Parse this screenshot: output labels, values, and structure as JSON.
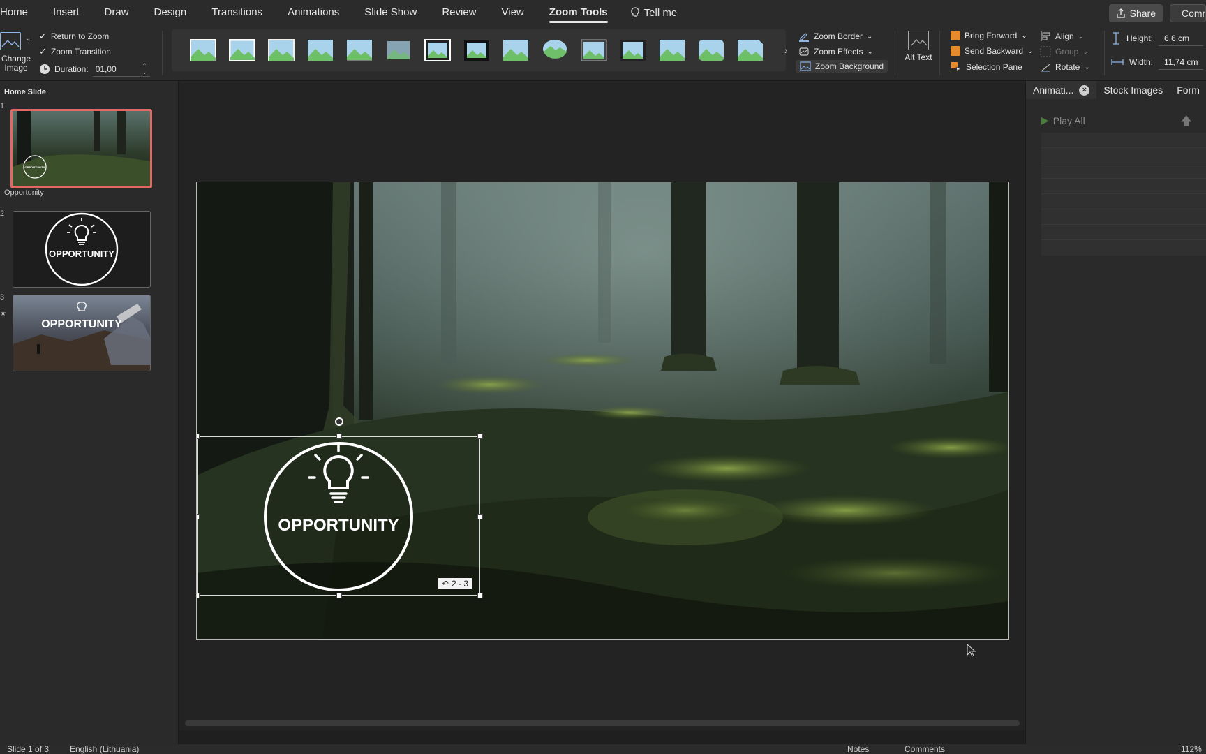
{
  "tabs": [
    "Home",
    "Insert",
    "Draw",
    "Design",
    "Transitions",
    "Animations",
    "Slide Show",
    "Review",
    "View",
    "Zoom Tools"
  ],
  "active_tab": "Zoom Tools",
  "tell_me": "Tell me",
  "share_label": "Share",
  "comments_label": "Comments",
  "ribbon": {
    "change_image": "Change Image",
    "return_to_zoom": "Return to Zoom",
    "zoom_transition": "Zoom Transition",
    "duration_label": "Duration:",
    "duration_value": "01,00",
    "zoom_border": "Zoom Border",
    "zoom_effects": "Zoom Effects",
    "zoom_background": "Zoom Background",
    "alt_text": "Alt Text",
    "bring_forward": "Bring Forward",
    "send_backward": "Send Backward",
    "selection_pane": "Selection Pane",
    "align": "Align",
    "group": "Group",
    "rotate": "Rotate",
    "height_label": "Height:",
    "height_value": "6,6 cm",
    "width_label": "Width:",
    "width_value": "11,74 cm"
  },
  "slides_panel": {
    "section_home": "Home Slide",
    "section_opportunity": "Opportunity",
    "slide_numbers": [
      "1",
      "2",
      "3"
    ],
    "thumb_text": "OPPORTUNITY"
  },
  "canvas": {
    "zoom_text": "OPPORTUNITY",
    "zoom_badge": "2 - 3"
  },
  "right_pane": {
    "tabs": [
      "Animati...",
      "Stock Images",
      "Form"
    ],
    "play_all": "Play All"
  },
  "status": {
    "slide_counter": "Slide 1 of 3",
    "language": "English (Lithuania)",
    "notes": "Notes",
    "comments": "Comments",
    "zoom": "112%"
  },
  "colors": {
    "accent_selected": "#e06a63",
    "bring_forward": "#e58a2d",
    "send_backward": "#e58a2d"
  }
}
